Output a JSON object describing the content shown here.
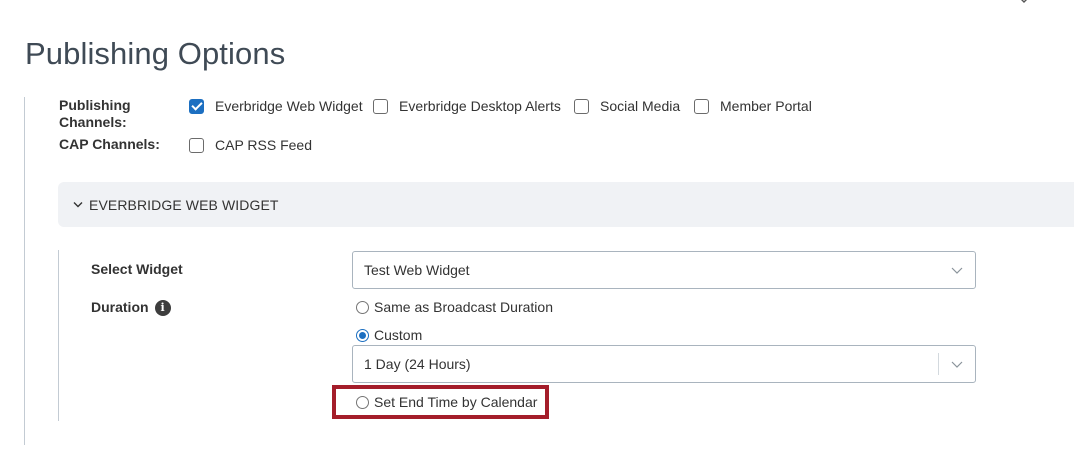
{
  "page": {
    "title": "Publishing Options"
  },
  "publishing": {
    "channels_label_line1": "Publishing",
    "channels_label_line2": "Channels:",
    "channels": [
      {
        "label": "Everbridge Web Widget",
        "checked": true
      },
      {
        "label": "Everbridge Desktop Alerts",
        "checked": false
      },
      {
        "label": "Social Media",
        "checked": false
      },
      {
        "label": "Member Portal",
        "checked": false
      }
    ],
    "cap_label": "CAP Channels:",
    "cap_channels": [
      {
        "label": "CAP RSS Feed",
        "checked": false
      }
    ]
  },
  "web_widget_section": {
    "title": "EVERBRIDGE WEB WIDGET",
    "expanded": true,
    "select_widget_label": "Select Widget",
    "select_widget_value": "Test Web Widget",
    "duration_label": "Duration",
    "duration_options": [
      {
        "label": "Same as Broadcast Duration",
        "selected": false
      },
      {
        "label": "Custom",
        "selected": true
      },
      {
        "label": "Set End Time by Calendar",
        "selected": false
      }
    ],
    "custom_duration_value": "1 Day (24 Hours)"
  },
  "icons": {
    "check": "check-icon",
    "chevron": "chevron-down-icon",
    "info": "info-icon"
  },
  "colors": {
    "accent": "#1c6fc1",
    "title": "#3f4a55",
    "highlight": "#a41d2a",
    "accordion_bg": "#f0f2f5"
  }
}
